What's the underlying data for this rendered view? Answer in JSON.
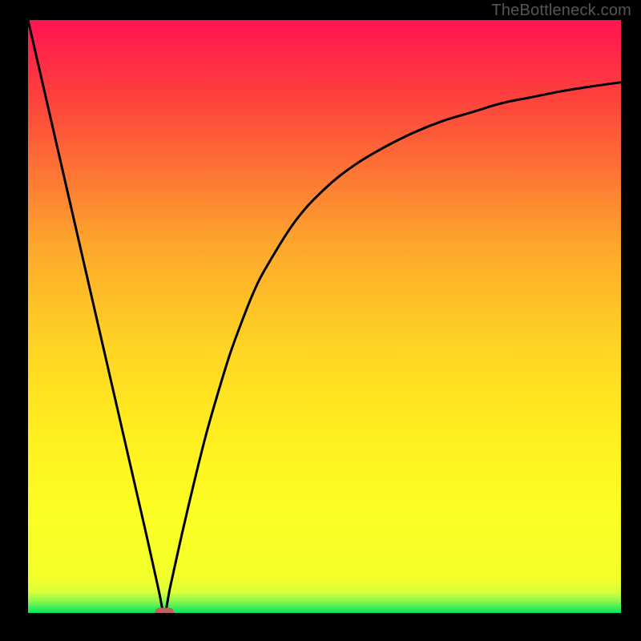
{
  "watermark": "TheBottleneck.com",
  "chart_data": {
    "type": "line",
    "title": "",
    "xlabel": "",
    "ylabel": "",
    "xlim": [
      0,
      100
    ],
    "ylim": [
      0,
      100
    ],
    "grid": false,
    "legend": false,
    "background_gradient": [
      "#ff1451",
      "#fd3d3d",
      "#fda72c",
      "#ffd423",
      "#ffef1f",
      "#fbff24",
      "#d9ff39",
      "#00e85f"
    ],
    "gradient_note": "vertical gradient top→bottom; green band only at very bottom ~3% height",
    "series": [
      {
        "name": "curve",
        "color": "#000000",
        "x": [
          0,
          2,
          4,
          6,
          8,
          10,
          12,
          14,
          16,
          18,
          20,
          22,
          23,
          24,
          26,
          28,
          30,
          32,
          34,
          36,
          38,
          40,
          45,
          50,
          55,
          60,
          65,
          70,
          75,
          80,
          85,
          90,
          95,
          100
        ],
        "y": [
          100,
          91.3,
          82.6,
          73.9,
          65.2,
          56.5,
          47.8,
          39.1,
          30.4,
          21.7,
          13.0,
          4.0,
          0.0,
          4.5,
          13.5,
          22.0,
          30.0,
          37.0,
          43.5,
          49.0,
          54.0,
          58.0,
          66.0,
          71.5,
          75.5,
          78.5,
          81.0,
          83.0,
          84.5,
          86.0,
          87.0,
          88.0,
          88.8,
          89.5
        ]
      }
    ],
    "marker": {
      "name": "minimum-marker",
      "x": 23,
      "y": 0,
      "color": "#c0625b",
      "shape": "rounded-rect"
    }
  }
}
